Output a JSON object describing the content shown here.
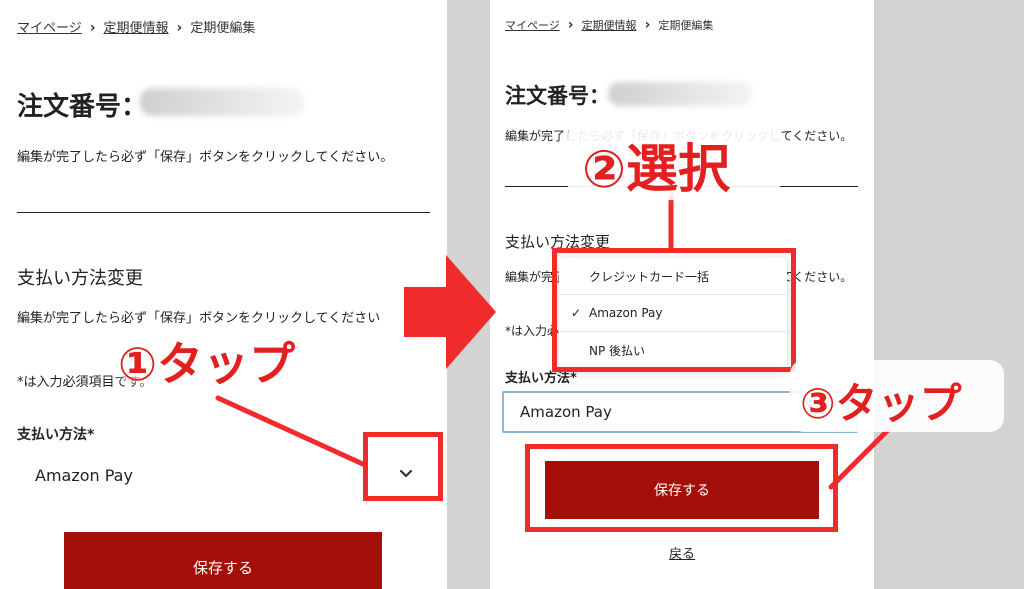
{
  "left": {
    "breadcrumb": [
      "マイページ",
      "定期便情報",
      "定期便編集"
    ],
    "order_title": "注文番号：",
    "save_note": "編集が完了したら必ず「保存」ボタンをクリックしてください。",
    "section_title": "支払い方法変更",
    "section_note": "編集が完了したら必ず「保存」ボタンをクリックしてください",
    "required_note": "*は入力必須項目です。",
    "payment_label": "支払い方法*",
    "payment_value": "Amazon Pay",
    "save_button": "保存する"
  },
  "right": {
    "breadcrumb": [
      "マイページ",
      "定期便情報",
      "定期便編集"
    ],
    "order_title": "注文番号：",
    "save_note": "編集が完了したら必ず「保存」ボタンをクリックしてください。",
    "section_title": "支払い方法変更",
    "section_note": "編集が完了したら必ず「保存」ボタンをクリックしてください。",
    "required_note": "*は入力必須項目です。",
    "payment_label": "支払い方法*",
    "payment_value": "Amazon Pay",
    "dropdown_options": [
      "クレジットカード一括",
      "Amazon Pay",
      "NP 後払い"
    ],
    "selected_option": "Amazon Pay",
    "save_button": "保存する",
    "back_link": "戻る"
  },
  "annotations": {
    "step1": "①タップ",
    "step2": "②選択",
    "step3": "③タップ"
  },
  "colors": {
    "button_red": "#a50f0a",
    "annotation_red": "#e31f1f",
    "focus_border": "#8fb3d9"
  }
}
